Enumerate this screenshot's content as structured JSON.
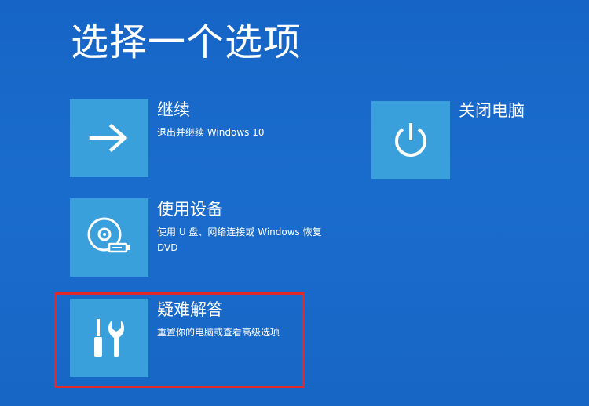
{
  "page": {
    "title": "选择一个选项"
  },
  "options": [
    {
      "id": "continue",
      "title": "继续",
      "description": "退出并继续 Windows 10",
      "icon": "arrow-right-icon"
    },
    {
      "id": "use-device",
      "title": "使用设备",
      "description_lines": [
        "使用 U 盘、网络连接或 Windows 恢复",
        "DVD"
      ],
      "icon": "disc-drive-icon"
    },
    {
      "id": "troubleshoot",
      "title": "疑难解答",
      "description": "重置你的电脑或查看高级选项",
      "icon": "tools-icon",
      "highlighted": true
    },
    {
      "id": "shutdown",
      "title": "关闭电脑",
      "icon": "power-icon"
    }
  ],
  "colors": {
    "background": "#1a6ccc",
    "tile": "#3aa0dc",
    "highlight": "#e0292c",
    "text": "#ffffff"
  }
}
